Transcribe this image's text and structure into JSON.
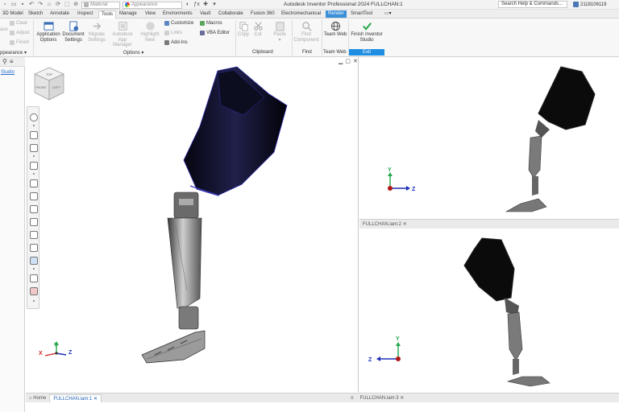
{
  "window": {
    "app_title": "Autodesk Inventor Professional 2024   FULLCHAN:1",
    "search_placeholder": "Search Help & Commands...",
    "user_id": "2118106119"
  },
  "quick_access": {
    "material_combo": "Material",
    "appearance_combo": "Appearance"
  },
  "tabs": [
    {
      "label": "3D Model"
    },
    {
      "label": "Sketch"
    },
    {
      "label": "Annotate"
    },
    {
      "label": "Inspect"
    },
    {
      "label": "Tools"
    },
    {
      "label": "Manage"
    },
    {
      "label": "View"
    },
    {
      "label": "Environments"
    },
    {
      "label": "Vault"
    },
    {
      "label": "Collaborate"
    },
    {
      "label": "Fusion 360"
    },
    {
      "label": "Electromechanical"
    },
    {
      "label": "Render"
    },
    {
      "label": "SmartTool"
    }
  ],
  "ribbon": {
    "appearance_small": {
      "clear": "Clear",
      "adjust": "Adjust",
      "finish": "Finish",
      "face": "ace",
      "panel_label": "ppearance"
    },
    "options_panel": {
      "application_options": "Application Options",
      "document_settings": "Document Settings",
      "migrate_settings": "Migrate Settings",
      "app_manager": "Autodesk App Manager",
      "highlight_new": "Highlight New",
      "customize": "Customize",
      "links": "Links",
      "addins": "Add-Ins",
      "macros": "Macros",
      "vba_editor": "VBA Editor",
      "panel_label": "Options"
    },
    "clipboard_panel": {
      "copy": "Copy",
      "cut": "Cut",
      "paste": "Paste",
      "panel_label": "Clipboard"
    },
    "find_panel": {
      "find_component": "Find Component",
      "panel_label": "Find"
    },
    "teamweb_panel": {
      "team_web": "Team Web",
      "panel_label": "Team Web"
    },
    "exit_panel": {
      "finish_studio": "Finish Inventor Studio",
      "panel_label": "Exit"
    }
  },
  "browser": {
    "studio_link": "Studio"
  },
  "viewcube": {
    "front": "FRONT",
    "left": "LEFT",
    "top": "TOP"
  },
  "documents": {
    "home_tab": "Home",
    "main_tab": "FULLCHAN.iam:1",
    "tr_tab": "FULLCHAN.iam:2",
    "br_tab": "FULLCHAN.iam:3"
  },
  "axes": {
    "x": "X",
    "y": "Y",
    "z": "Z"
  },
  "colors": {
    "accent": "#1f8de0",
    "render_tab": "#3b8fd8",
    "axis_x": "#d12020",
    "axis_y": "#22a64a",
    "axis_z": "#1c2fb8"
  }
}
